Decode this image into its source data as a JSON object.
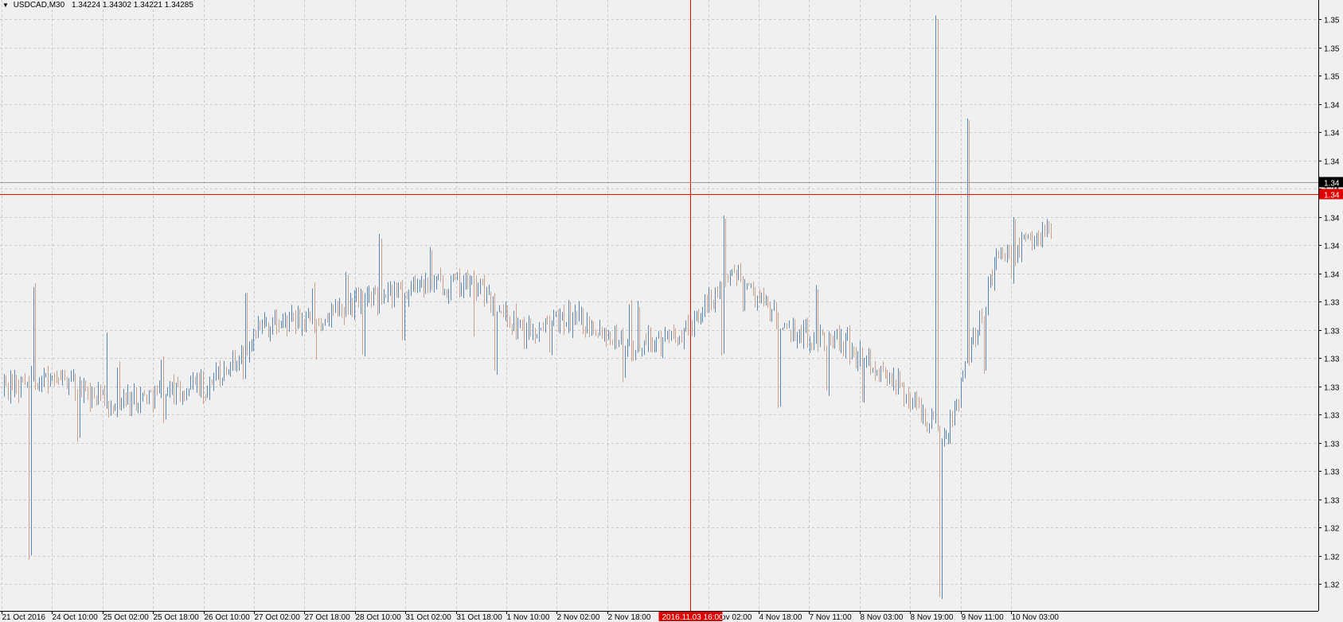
{
  "window": {
    "symbol": "USDCAD,M30",
    "ohlc": "1.34224 1.34302 1.34221 1.34285"
  },
  "colors": {
    "background": "#f0f0f0",
    "grid": "#c8c8c8",
    "bar": "#5a86b3",
    "bar_alt": "#c9a08a",
    "crosshair": "#ff0000",
    "axis": "#000000",
    "price_badge": "#000000",
    "cursor_badge": "#e00000"
  },
  "price_axis": {
    "labels": [
      "1.35",
      "1.35",
      "1.35",
      "1.34",
      "1.34",
      "1.34",
      "1.34",
      "1.34",
      "1.34",
      "1.34",
      "1.33",
      "1.33",
      "1.33",
      "1.33",
      "1.33",
      "1.33",
      "1.33",
      "1.33",
      "1.32",
      "1.32",
      "1.32"
    ],
    "cursor_label": "1.34",
    "current_label": "1.34"
  },
  "time_axis": {
    "labels": [
      "21 Oct 2016",
      "24 Oct 10:00",
      "25 Oct 02:00",
      "25 Oct 18:00",
      "26 Oct 10:00",
      "27 Oct 02:00",
      "27 Oct 18:00",
      "28 Oct 10:00",
      "31 Oct 02:00",
      "31 Oct 18:00",
      "1 Nov 10:00",
      "2 Nov 02:00",
      "2 Nov 18:00",
      "3 Nov 10:00",
      "4 Nov 02:00",
      "4 Nov 18:00",
      "7 Nov 11:00",
      "8 Nov 03:00",
      "8 Nov 19:00",
      "9 Nov 11:00",
      "10 Nov 03:00"
    ],
    "cursor_label": "2016.11.03 16:00",
    "cursor_index": 13
  },
  "chart_data": {
    "type": "ohlc",
    "symbol": "USDCAD",
    "timeframe": "M30",
    "ylim": [
      1.319,
      1.353
    ],
    "grid": true,
    "crosshair": {
      "time": "2016.11.03 16:00",
      "price": 1.3422
    },
    "current_price": 1.34285,
    "x": [
      "21 Oct 2016",
      "24 Oct 10:00",
      "25 Oct 02:00",
      "25 Oct 18:00",
      "26 Oct 10:00",
      "27 Oct 02:00",
      "27 Oct 18:00",
      "28 Oct 10:00",
      "31 Oct 02:00",
      "31 Oct 18:00",
      "1 Nov 10:00",
      "2 Nov 02:00",
      "2 Nov 18:00",
      "3 Nov 10:00",
      "4 Nov 02:00",
      "4 Nov 18:00",
      "7 Nov 11:00",
      "8 Nov 03:00",
      "8 Nov 19:00",
      "9 Nov 11:00",
      "10 Nov 03:00"
    ],
    "close": [
      1.3313,
      1.3322,
      1.3306,
      1.3311,
      1.3316,
      1.3349,
      1.3352,
      1.3363,
      1.3371,
      1.3372,
      1.3344,
      1.3353,
      1.3338,
      1.3346,
      1.3378,
      1.3345,
      1.334,
      1.3318,
      1.3286,
      1.3388,
      1.3402
    ],
    "high": [
      1.3336,
      1.337,
      1.3343,
      1.3327,
      1.333,
      1.3365,
      1.337,
      1.3378,
      1.3397,
      1.339,
      1.3376,
      1.3362,
      1.3361,
      1.336,
      1.341,
      1.3363,
      1.3371,
      1.3349,
      1.3521,
      1.3465,
      1.3408
    ],
    "low": [
      1.3288,
      1.322,
      1.3286,
      1.3298,
      1.3296,
      1.332,
      1.333,
      1.3333,
      1.3341,
      1.3343,
      1.3322,
      1.3332,
      1.3318,
      1.333,
      1.3334,
      1.3304,
      1.3312,
      1.3307,
      1.3199,
      1.3324,
      1.3375
    ]
  }
}
